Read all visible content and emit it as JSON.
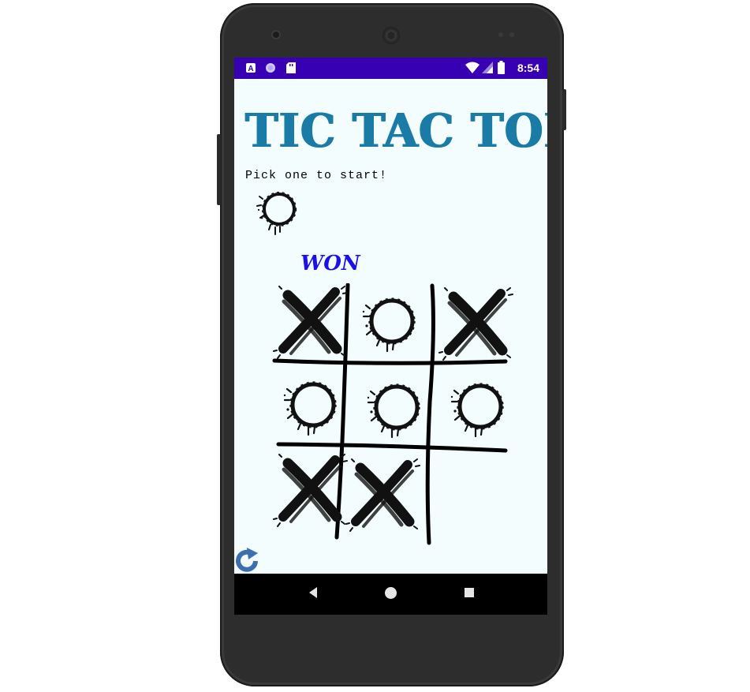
{
  "status_bar": {
    "time": "8:54",
    "left_icons": [
      "a-notification-icon",
      "circle-notification-icon",
      "sd-card-icon"
    ],
    "right_icons": [
      "wifi-icon",
      "signal-icon",
      "battery-icon"
    ]
  },
  "app": {
    "title": "TIC TAC TOE",
    "prompt": "Pick one to start!",
    "picker_option": "o",
    "result_text": "WON",
    "board": [
      [
        "x",
        "o",
        "x"
      ],
      [
        "o",
        "o",
        "o"
      ],
      [
        "x",
        "x",
        ""
      ]
    ],
    "reset_icon": "refresh-icon"
  },
  "nav_bar": {
    "buttons": [
      "back-icon",
      "home-icon",
      "recents-icon"
    ]
  },
  "colors": {
    "status_bar": "#3700b3",
    "background": "#f4fdfe",
    "title": "#1a7ba6",
    "result": "#1a10e8",
    "reset_icon": "#3b6fb0"
  }
}
